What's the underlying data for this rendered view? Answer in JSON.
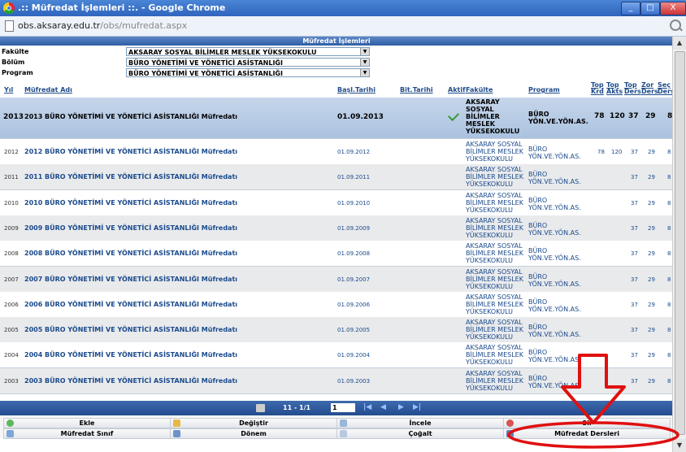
{
  "window": {
    "title": ".:: Müfredat İşlemleri ::. - Google Chrome",
    "min": "_",
    "max": "□",
    "close": "X"
  },
  "address": {
    "host": "obs.aksaray.edu.tr",
    "path": "/obs/mufredat.aspx"
  },
  "panel": {
    "title": "Müfredat İşlemleri"
  },
  "filters": {
    "fakulte_label": "Fakülte",
    "fakulte_value": "AKSARAY SOSYAL BİLİMLER MESLEK YÜKSEKOKULU",
    "bolum_label": "Bölüm",
    "bolum_value": "BÜRO YÖNETİMİ VE YÖNETİCİ ASİSTANLIĞI",
    "program_label": "Program",
    "program_value": "BÜRO YÖNETİMİ VE YÖNETİCİ ASİSTANLIĞI"
  },
  "columns": {
    "yil": "Yıl",
    "ad": "Müfredat Adı",
    "basl": "Başl.Tarihi",
    "bit": "Bit.Tarihi",
    "aktif": "Aktif",
    "fakulte": "Fakülte",
    "program": "Program",
    "topkrd": "Top Krd",
    "topakts": "Top Akts",
    "topders": "Top Ders",
    "zorders": "Zor Ders",
    "secders": "Seç Ders"
  },
  "rows": [
    {
      "yil": "2013",
      "ad": "2013 BÜRO YÖNETİMİ VE YÖNETİCİ ASİSTANLIĞI Müfredatı",
      "tarih": "01.09.2013",
      "fak": "AKSARAY SOSYAL BİLİMLER MESLEK YÜKSEKOKULU",
      "prog": "BÜRO YÖN.VE.YÖN.AS.",
      "krd": "78",
      "akts": "120",
      "top": "37",
      "zor": "29",
      "sec": "8"
    },
    {
      "yil": "2012",
      "ad": "2012 BÜRO YÖNETİMİ VE YÖNETİCİ ASİSTANLIĞI Müfredatı",
      "tarih": "01.09.2012",
      "fak": "AKSARAY SOSYAL BİLİMLER MESLEK YÜKSEKOKULU",
      "prog": "BÜRO YÖN.VE.YÖN.AS.",
      "krd": "78",
      "akts": "120",
      "top": "37",
      "zor": "29",
      "sec": "8"
    },
    {
      "yil": "2011",
      "ad": "2011 BÜRO YÖNETİMİ VE YÖNETİCİ ASİSTANLIĞI Müfredatı",
      "tarih": "01.09.2011",
      "fak": "AKSARAY SOSYAL BİLİMLER MESLEK YÜKSEKOKULU",
      "prog": "BÜRO YÖN.VE.YÖN.AS.",
      "krd": "",
      "akts": "",
      "top": "37",
      "zor": "29",
      "sec": "8"
    },
    {
      "yil": "2010",
      "ad": "2010 BÜRO YÖNETİMİ VE YÖNETİCİ ASİSTANLIĞI Müfredatı",
      "tarih": "01.09.2010",
      "fak": "AKSARAY SOSYAL BİLİMLER MESLEK YÜKSEKOKULU",
      "prog": "BÜRO YÖN.VE.YÖN.AS.",
      "krd": "",
      "akts": "",
      "top": "37",
      "zor": "29",
      "sec": "8"
    },
    {
      "yil": "2009",
      "ad": "2009 BÜRO YÖNETİMİ VE YÖNETİCİ ASİSTANLIĞI Müfredatı",
      "tarih": "01.09.2009",
      "fak": "AKSARAY SOSYAL BİLİMLER MESLEK YÜKSEKOKULU",
      "prog": "BÜRO YÖN.VE.YÖN.AS.",
      "krd": "",
      "akts": "",
      "top": "37",
      "zor": "29",
      "sec": "8"
    },
    {
      "yil": "2008",
      "ad": "2008 BÜRO YÖNETİMİ VE YÖNETİCİ ASİSTANLIĞI Müfredatı",
      "tarih": "01.09.2008",
      "fak": "AKSARAY SOSYAL BİLİMLER MESLEK YÜKSEKOKULU",
      "prog": "BÜRO YÖN.VE.YÖN.AS.",
      "krd": "",
      "akts": "",
      "top": "37",
      "zor": "29",
      "sec": "8"
    },
    {
      "yil": "2007",
      "ad": "2007 BÜRO YÖNETİMİ VE YÖNETİCİ ASİSTANLIĞI Müfredatı",
      "tarih": "01.09.2007",
      "fak": "AKSARAY SOSYAL BİLİMLER MESLEK YÜKSEKOKULU",
      "prog": "BÜRO YÖN.VE.YÖN.AS.",
      "krd": "",
      "akts": "",
      "top": "37",
      "zor": "29",
      "sec": "8"
    },
    {
      "yil": "2006",
      "ad": "2006 BÜRO YÖNETİMİ VE YÖNETİCİ ASİSTANLIĞI Müfredatı",
      "tarih": "01.09.2006",
      "fak": "AKSARAY SOSYAL BİLİMLER MESLEK YÜKSEKOKULU",
      "prog": "BÜRO YÖN.VE.YÖN.AS.",
      "krd": "",
      "akts": "",
      "top": "37",
      "zor": "29",
      "sec": "8"
    },
    {
      "yil": "2005",
      "ad": "2005 BÜRO YÖNETİMİ VE YÖNETİCİ ASİSTANLIĞI Müfredatı",
      "tarih": "01.09.2005",
      "fak": "AKSARAY SOSYAL BİLİMLER MESLEK YÜKSEKOKULU",
      "prog": "BÜRO YÖN.VE.YÖN.AS.",
      "krd": "",
      "akts": "",
      "top": "37",
      "zor": "29",
      "sec": "8"
    },
    {
      "yil": "2004",
      "ad": "2004 BÜRO YÖNETİMİ VE YÖNETİCİ ASİSTANLIĞI Müfredatı",
      "tarih": "01.09.2004",
      "fak": "AKSARAY SOSYAL BİLİMLER MESLEK YÜKSEKOKULU",
      "prog": "BÜRO YÖN.VE.YÖN.AS.",
      "krd": "",
      "akts": "",
      "top": "37",
      "zor": "29",
      "sec": "8"
    },
    {
      "yil": "2003",
      "ad": "2003 BÜRO YÖNETİMİ VE YÖNETİCİ ASİSTANLIĞI Müfredatı",
      "tarih": "01.09.2003",
      "fak": "AKSARAY SOSYAL BİLİMLER MESLEK YÜKSEKOKULU",
      "prog": "BÜRO YÖN.VE.YÖN.AS.",
      "krd": "",
      "akts": "",
      "top": "37",
      "zor": "29",
      "sec": "8"
    }
  ],
  "pager": {
    "info": "11 - 1/1",
    "page": "1"
  },
  "toolbar": {
    "ekle": "Ekle",
    "degistir": "Değiştir",
    "incele": "İncele",
    "sil": "Sil",
    "mufredat_sinif": "Müfredat Sınıf",
    "donem": "Dönem",
    "cogalt": "Çoğalt",
    "mufredat_dersleri": "Müfredat Dersleri"
  },
  "colors": {
    "title_bar": "#2f65bd",
    "panel_header": "#2e5ea6",
    "link": "#1a4a8c",
    "annotation": "#e01010"
  }
}
